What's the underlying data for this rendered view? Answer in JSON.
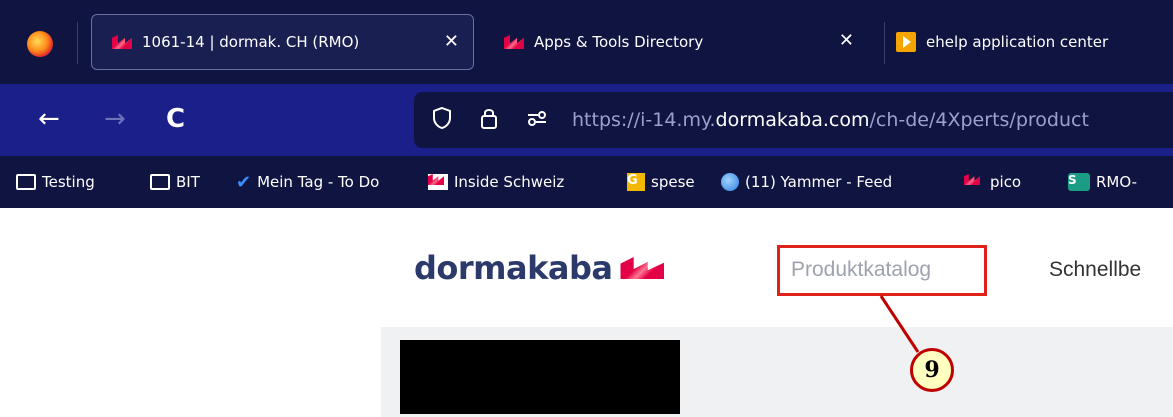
{
  "browser": {
    "tabs": [
      {
        "label": "1061-14 | dormak. CH (RMO)",
        "close": "✕",
        "icon": "dormakaba-icon",
        "active": true
      },
      {
        "label": "Apps & Tools Directory",
        "close": "✕",
        "icon": "dormakaba-icon",
        "active": false
      },
      {
        "label": "ehelp application center",
        "icon": "ehelp-icon",
        "active": false
      }
    ],
    "nav": {
      "back": "←",
      "forward": "→",
      "reload": "C"
    },
    "url": {
      "prefix": "https://i-14.my.",
      "domain": "dormakaba.com",
      "suffix": "/ch-de/4Xperts/product"
    },
    "bookmarks": [
      {
        "label": "Testing",
        "icon": "folder-icon"
      },
      {
        "label": "BIT",
        "icon": "folder-icon"
      },
      {
        "label": "Mein Tag - To Do",
        "icon": "check-icon"
      },
      {
        "label": "Inside Schweiz",
        "icon": "dormakaba-icon"
      },
      {
        "label": "spese",
        "icon": "spese-icon"
      },
      {
        "label": "(11) Yammer - Feed",
        "icon": "yammer-icon"
      },
      {
        "label": "pico",
        "icon": "dormakaba-icon"
      },
      {
        "label": "RMO-",
        "icon": "sharepoint-icon"
      }
    ]
  },
  "page": {
    "logo_text": "dormakaba",
    "nav_links": [
      "Produktkatalog",
      "Schnellbe"
    ],
    "callout_number": "9",
    "accent_color": "#e0201a"
  }
}
